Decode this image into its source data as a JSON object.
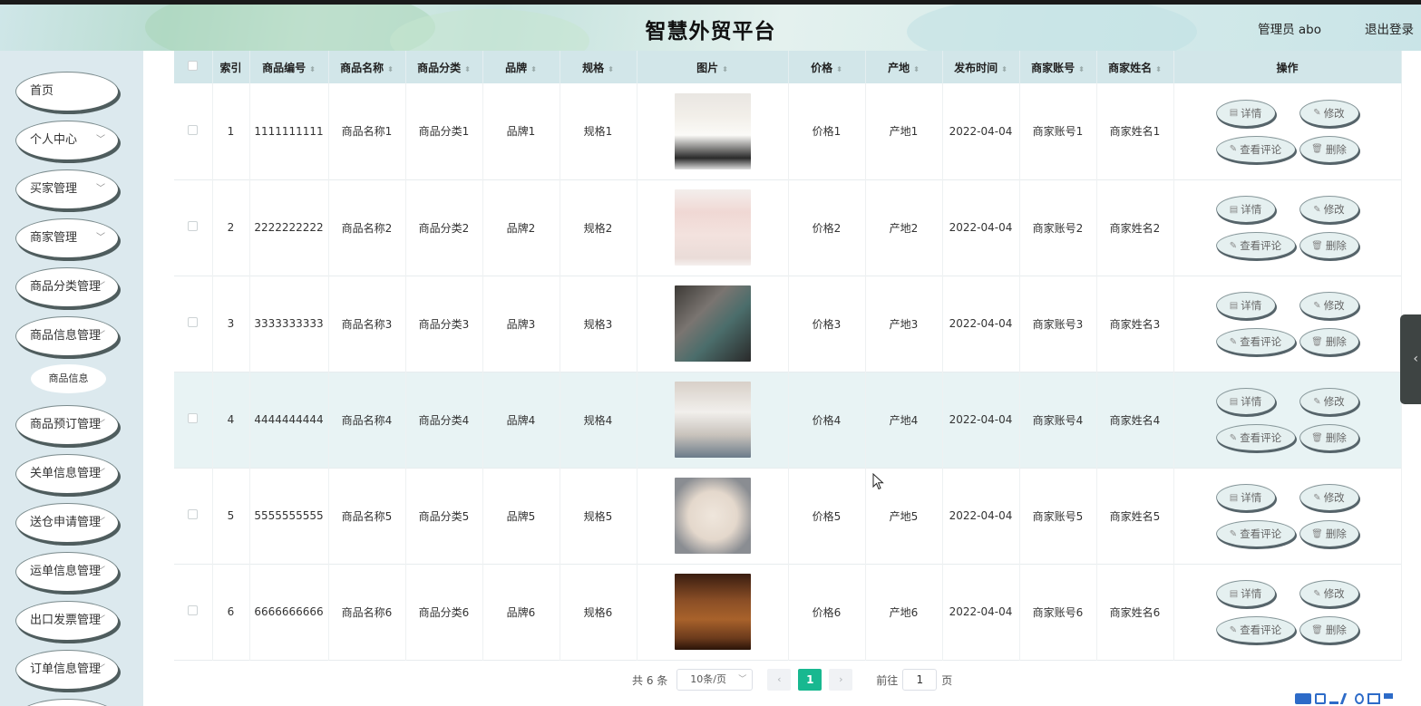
{
  "header": {
    "title": "智慧外贸平台",
    "user": "管理员 abo",
    "logout": "退出登录"
  },
  "sidebar": {
    "items": [
      {
        "label": "首页",
        "has_children": false
      },
      {
        "label": "个人中心",
        "has_children": true
      },
      {
        "label": "买家管理",
        "has_children": true
      },
      {
        "label": "商家管理",
        "has_children": true
      },
      {
        "label": "商品分类管理",
        "has_children": true
      },
      {
        "label": "商品信息管理",
        "has_children": true
      },
      {
        "label": "商品预订管理",
        "has_children": true
      },
      {
        "label": "关单信息管理",
        "has_children": true
      },
      {
        "label": "送仓申请管理",
        "has_children": true
      },
      {
        "label": "运单信息管理",
        "has_children": true
      },
      {
        "label": "出口发票管理",
        "has_children": true
      },
      {
        "label": "订单信息管理",
        "has_children": true
      }
    ],
    "subitem": "商品信息"
  },
  "table": {
    "columns": [
      "索引",
      "商品编号",
      "商品名称",
      "商品分类",
      "品牌",
      "规格",
      "图片",
      "价格",
      "产地",
      "发布时间",
      "商家账号",
      "商家姓名",
      "操作"
    ],
    "rows": [
      {
        "index": "1",
        "code": "1111111111",
        "name": "商品名称1",
        "category": "商品分类1",
        "brand": "品牌1",
        "spec": "规格1",
        "price": "价格1",
        "origin": "产地1",
        "date": "2022-04-04",
        "account": "商家账号1",
        "merchant": "商家姓名1"
      },
      {
        "index": "2",
        "code": "2222222222",
        "name": "商品名称2",
        "category": "商品分类2",
        "brand": "品牌2",
        "spec": "规格2",
        "price": "价格2",
        "origin": "产地2",
        "date": "2022-04-04",
        "account": "商家账号2",
        "merchant": "商家姓名2"
      },
      {
        "index": "3",
        "code": "3333333333",
        "name": "商品名称3",
        "category": "商品分类3",
        "brand": "品牌3",
        "spec": "规格3",
        "price": "价格3",
        "origin": "产地3",
        "date": "2022-04-04",
        "account": "商家账号3",
        "merchant": "商家姓名3"
      },
      {
        "index": "4",
        "code": "4444444444",
        "name": "商品名称4",
        "category": "商品分类4",
        "brand": "品牌4",
        "spec": "规格4",
        "price": "价格4",
        "origin": "产地4",
        "date": "2022-04-04",
        "account": "商家账号4",
        "merchant": "商家姓名4"
      },
      {
        "index": "5",
        "code": "5555555555",
        "name": "商品名称5",
        "category": "商品分类5",
        "brand": "品牌5",
        "spec": "规格5",
        "price": "价格5",
        "origin": "产地5",
        "date": "2022-04-04",
        "account": "商家账号5",
        "merchant": "商家姓名5"
      },
      {
        "index": "6",
        "code": "6666666666",
        "name": "商品名称6",
        "category": "商品分类6",
        "brand": "品牌6",
        "spec": "规格6",
        "price": "价格6",
        "origin": "产地6",
        "date": "2022-04-04",
        "account": "商家账号6",
        "merchant": "商家姓名6"
      }
    ],
    "actions": {
      "detail": "详情",
      "edit": "修改",
      "comments": "查看评论",
      "delete": "删除"
    }
  },
  "pagination": {
    "total": "共 6 条",
    "page_size": "10条/页",
    "current_page": "1",
    "goto_label": "前往",
    "goto_value": "1",
    "page_suffix": "页"
  },
  "colors": {
    "header_row": "#d2e6e9",
    "accent": "#18b890",
    "sidebar_bg": "#dce9ee"
  }
}
